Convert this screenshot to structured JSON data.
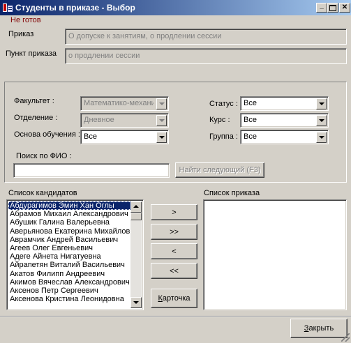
{
  "window": {
    "title": "Студенты в приказе - Выбор",
    "controls": [
      "minimize-icon",
      "maximize-icon",
      "close-icon"
    ]
  },
  "status_text": "Не готов",
  "order": {
    "label": "Приказ",
    "value": "О допуске к занятиям, о продлении сессии"
  },
  "order_item": {
    "label": "Пункт приказа",
    "value": "о продлении сессии"
  },
  "filters": {
    "faculty": {
      "label": "Факультет :",
      "value": "Математико-механи",
      "disabled": true
    },
    "department": {
      "label": "Отделение :",
      "value": "Дневное",
      "disabled": true
    },
    "study_basis": {
      "label": "Основа обучения :",
      "value": "Все"
    },
    "status": {
      "label": "Статус :",
      "value": "Все"
    },
    "course": {
      "label": "Курс :",
      "value": "Все"
    },
    "group": {
      "label": "Группа :",
      "value": "Все"
    }
  },
  "search": {
    "label": "Поиск по ФИО :",
    "value": "",
    "find_next": "Найти следующий (F3)"
  },
  "candidates": {
    "label": "Список кандидатов",
    "selected_index": 0,
    "items": [
      "Абдурагимов Эмин Хан Оглы",
      "Абрамов Михаил Александрович",
      "Абушик Галина Валерьевна",
      "Аверьянова Екатерина Михайловна",
      "Аврамчик Андрей Васильевич",
      "Агеев Олег Евгеньевич",
      "Адеге Айнета Нигатуевна",
      "Айрапетян Виталий Васильевич",
      "Акатов Филипп Андреевич",
      "Акимов Вячеслав Александрович",
      "Аксенов Петр Сергеевич",
      "Аксенова Кристина Леонидовна"
    ]
  },
  "order_list": {
    "label": "Список приказа",
    "items": []
  },
  "transfer_buttons": {
    "add": ">",
    "add_all": ">>",
    "remove": "<",
    "remove_all": "<<",
    "card_prefix": "",
    "card_hotkey": "К",
    "card_rest": "арточка"
  },
  "close_button": {
    "hotkey": "З",
    "rest": "акрыть"
  },
  "colors": {
    "face": "#d4d0c8",
    "title_start": "#0a246a",
    "title_end": "#a6caf0",
    "status": "#800000",
    "selection": "#0a246a"
  }
}
